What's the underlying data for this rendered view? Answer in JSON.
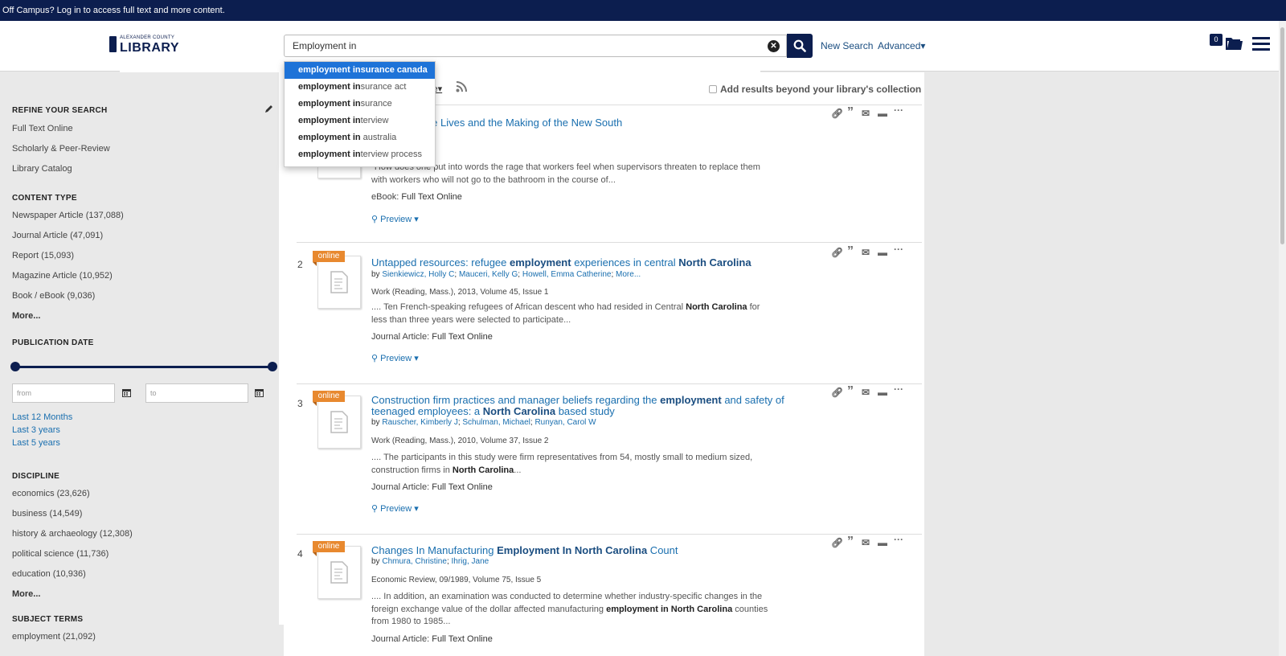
{
  "banner": {
    "text": "Off Campus? Log in to access full text and more content."
  },
  "header": {
    "logo_top": "ALEXANDER COUNTY",
    "logo_main": "LIBRARY",
    "search_value": "Employment in",
    "new_search": "New Search",
    "advanced": "Advanced▾",
    "folder_count": "0"
  },
  "autocomplete": [
    {
      "bold": "employment in",
      "rest": "surance canada"
    },
    {
      "bold": "employment in",
      "rest": "surance act"
    },
    {
      "bold": "employment in",
      "rest": "surance"
    },
    {
      "bold": "employment in",
      "rest": "terview"
    },
    {
      "bold": "employment in",
      "rest": " australia"
    },
    {
      "bold": "employment in",
      "rest": "terview process"
    }
  ],
  "sidebar": {
    "refine_heading": "REFINE YOUR SEARCH",
    "refine": [
      "Full Text Online",
      "Scholarly & Peer-Review",
      "Library Catalog"
    ],
    "content_heading": "CONTENT TYPE",
    "content": [
      "Newspaper Article (137,088)",
      "Journal Article (47,091)",
      "Report (15,093)",
      "Magazine Article (10,952)",
      "Book / eBook (9,036)"
    ],
    "content_more": "More...",
    "pubdate_heading": "PUBLICATION DATE",
    "from_placeholder": "from",
    "to_placeholder": "to",
    "date_links": [
      "Last 12 Months",
      "Last 3 years",
      "Last 5 years"
    ],
    "discipline_heading": "DISCIPLINE",
    "discipline": [
      "economics (23,626)",
      "business (14,549)",
      "history & archaeology (12,308)",
      "political science (11,736)",
      "education (10,936)"
    ],
    "discipline_more": "More...",
    "subject_heading": "SUBJECT TERMS",
    "subject": [
      "employment (21,092)"
    ]
  },
  "toolbar": {
    "sort_fragment": "ce▾",
    "beyond_label": "Add results beyond your library's collection"
  },
  "results": [
    {
      "num": "",
      "title_html": "laughterhouse Lives and the Making of the New South",
      "snippet": "\"How does one put into words the rage that workers feel when supervisors threaten to replace them with workers who will not go to the bathroom in the course of...",
      "type_label": "eBook:",
      "type_link": "Full Text Online",
      "preview": "Preview ▾"
    },
    {
      "num": "2",
      "badge": "online",
      "title_html": "Untapped resources: refugee <b>employment</b> experiences in central <b>North Carolina</b>",
      "by_label": "by",
      "authors": [
        "Sienkiewicz, Holly C",
        "Mauceri, Kelly G",
        "Howell, Emma Catherine",
        "More..."
      ],
      "pub": "Work (Reading, Mass.), 2013, Volume 45, Issue 1",
      "snippet_html": ".... Ten French-speaking refugees of African descent who had resided in Central <b>North Carolina</b> for less than three years were selected to participate...",
      "type_label": "Journal Article:",
      "type_link": "Full Text Online",
      "preview": "Preview ▾"
    },
    {
      "num": "3",
      "badge": "online",
      "title_html": "Construction firm practices and manager beliefs regarding the <b>employment</b> and safety of teenaged employees: a <b>North Carolina</b> based study",
      "by_label": "by",
      "authors": [
        "Rauscher, Kimberly J",
        "Schulman, Michael",
        "Runyan, Carol W"
      ],
      "pub": "Work (Reading, Mass.), 2010, Volume 37, Issue 2",
      "snippet_html": ".... The participants in this study were firm representatives from 54, mostly small to medium sized, construction firms in <b>North Carolina</b>...",
      "type_label": "Journal Article:",
      "type_link": "Full Text Online",
      "preview": "Preview ▾"
    },
    {
      "num": "4",
      "badge": "online",
      "title_html": "Changes In Manufacturing <b>Employment In North Carolina</b> Count",
      "by_label": "by",
      "authors": [
        "Chmura, Christine",
        "Ihrig, Jane"
      ],
      "pub": "Economic Review, 09/1989, Volume 75, Issue 5",
      "snippet_html": ".... In addition, an examination was conducted to determine whether industry-specific changes in the foreign exchange value of the dollar affected manufacturing <b>employment in North Carolina</b> counties from 1980 to 1985...",
      "type_label": "Journal Article:",
      "type_link": "Full Text Online"
    }
  ],
  "colors": {
    "navy": "#0c1e4f",
    "link": "#1a6faf",
    "online_badge": "#e8892f",
    "highlight": "#1e73d8"
  }
}
